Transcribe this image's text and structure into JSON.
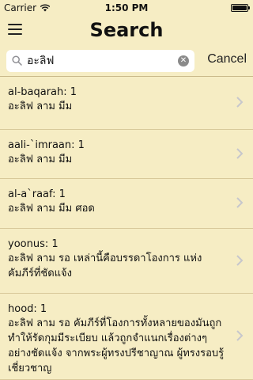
{
  "status_bar": {
    "carrier": "Carrier",
    "time": "1:50 PM"
  },
  "nav": {
    "title": "Search"
  },
  "search": {
    "query": "อะลิฟ",
    "cancel_label": "Cancel"
  },
  "results": [
    {
      "title": "al-baqarah: 1",
      "text": "อะลิฟ ลาม มีม"
    },
    {
      "title": "aali-`imraan: 1",
      "text": "อะลิฟ ลาม มีม"
    },
    {
      "title": "al-a`raaf: 1",
      "text": "อะลิฟ ลาม มีม ศอด"
    },
    {
      "title": "yoonus: 1",
      "text": "อะลิฟ ลาม รอ เหล่านี้คือบรรดาโองการ แห่งคัมภีร์ที่ชัดแจ้ง"
    },
    {
      "title": "hood: 1",
      "text": "อะลิฟ ลาม รอ คัมภีร์ที่โองการทั้งหลายของมันถูกทำให้รัดกุมมีระเบียบ แล้วถูกจำแนกเรื่องต่างๆ อย่างชัดแจ้ง จากพระผู้ทรงปรีชาญาณ ผู้ทรงรอบรู้เชี่ยวชาญ"
    }
  ]
}
